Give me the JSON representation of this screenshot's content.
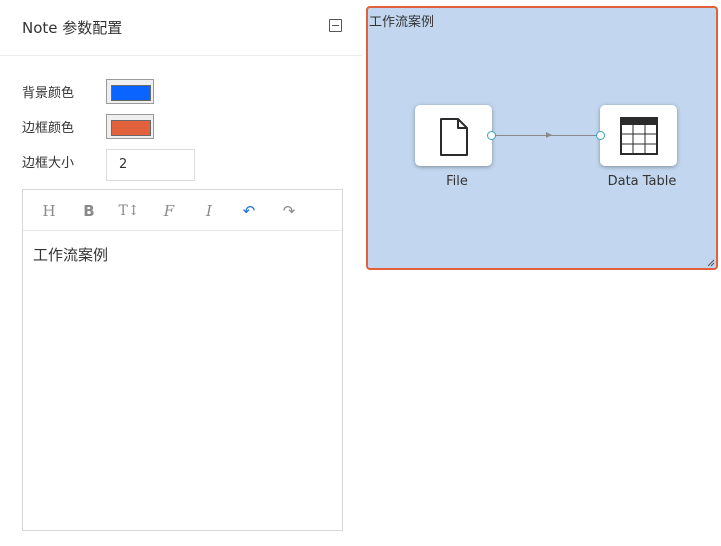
{
  "panel": {
    "title": "Note 参数配置",
    "collapse_icon": "minus-square-icon",
    "bg_color_label": "背景颜色",
    "bg_color_value": "#0a64ff",
    "border_color_label": "边框颜色",
    "border_color_value": "#e2603c",
    "border_size_label": "边框大小",
    "border_size_value": "2"
  },
  "editor": {
    "toolbar": [
      {
        "name": "heading-button",
        "glyph": "H"
      },
      {
        "name": "bold-button",
        "glyph": "B"
      },
      {
        "name": "text-size-button",
        "glyph": "T↕"
      },
      {
        "name": "font-button",
        "glyph": "F"
      },
      {
        "name": "italic-button",
        "glyph": "I"
      },
      {
        "name": "undo-button",
        "glyph": "↶"
      },
      {
        "name": "redo-button",
        "glyph": "↷"
      }
    ],
    "content": "工作流案例"
  },
  "canvas": {
    "note_text": "工作流案例",
    "note_bg": "#c2d7ef",
    "note_border": "#e2603c",
    "nodes": [
      {
        "label": "File",
        "icon": "file-icon"
      },
      {
        "label": "Data Table",
        "icon": "table-icon"
      }
    ]
  }
}
